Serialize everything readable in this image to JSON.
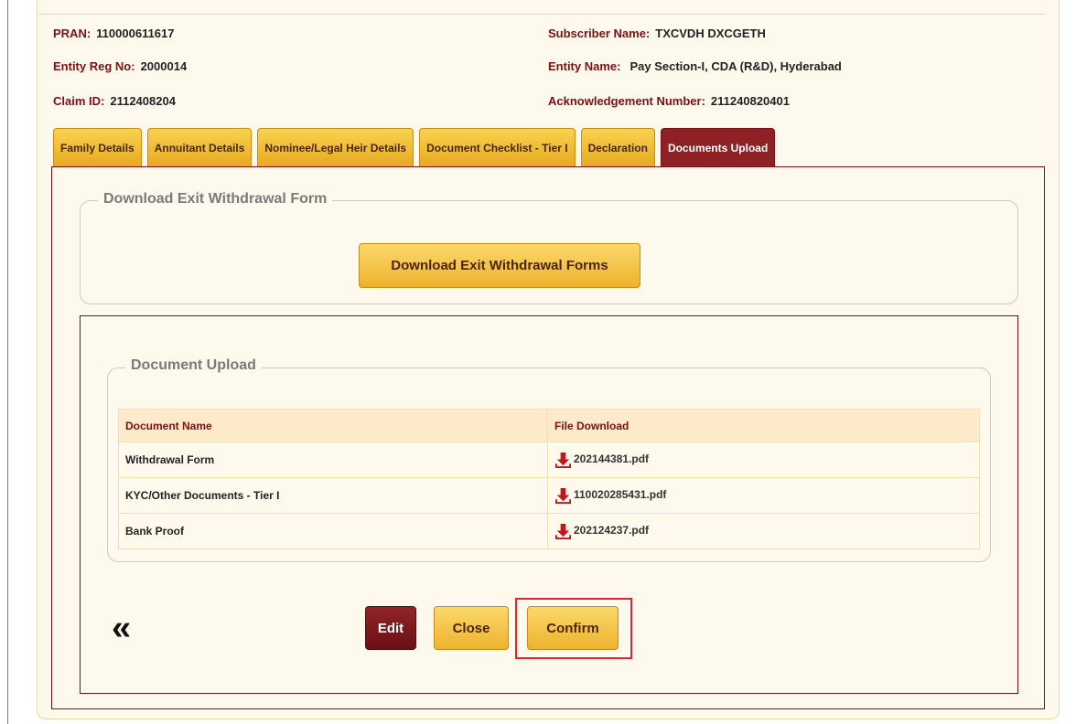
{
  "header": {
    "pran": {
      "label": "PRAN:",
      "value": "110000611617"
    },
    "subscriber_name": {
      "label": "Subscriber Name:",
      "value": "TXCVDH DXCGETH"
    },
    "entity_reg_no": {
      "label": "Entity Reg No:",
      "value": "2000014"
    },
    "entity_name": {
      "label": "Entity Name:",
      "value": "Pay Section-I, CDA (R&D), Hyderabad"
    },
    "claim_id": {
      "label": "Claim ID:",
      "value": "2112408204"
    },
    "ack_number": {
      "label": "Acknowledgement Number:",
      "value": "211240820401"
    }
  },
  "tabs": [
    {
      "label": "Family Details",
      "active": false
    },
    {
      "label": "Annuitant Details",
      "active": false
    },
    {
      "label": "Nominee/Legal Heir Details",
      "active": false
    },
    {
      "label": "Document Checklist - Tier I",
      "active": false
    },
    {
      "label": "Declaration",
      "active": false
    },
    {
      "label": "Documents Upload",
      "active": true
    }
  ],
  "download_section": {
    "legend": "Download Exit Withdrawal Form",
    "button_label": "Download Exit Withdrawal Forms"
  },
  "upload_section": {
    "legend": "Document Upload",
    "columns": [
      "Document Name",
      "File Download"
    ],
    "rows": [
      {
        "name": "Withdrawal Form",
        "file": "202144381.pdf"
      },
      {
        "name": "KYC/Other Documents - Tier I",
        "file": "110020285431.pdf"
      },
      {
        "name": "Bank Proof",
        "file": "202124237.pdf"
      }
    ]
  },
  "actions": {
    "back_icon": "double-chevron-left-icon",
    "back_glyph": "«",
    "edit_label": "Edit",
    "close_label": "Close",
    "confirm_label": "Confirm"
  },
  "colors": {
    "accent_maroon": "#7b1113",
    "gold": "#eeb22d",
    "highlight_red": "#e0262a",
    "card_bg": "#fdf9ec"
  }
}
